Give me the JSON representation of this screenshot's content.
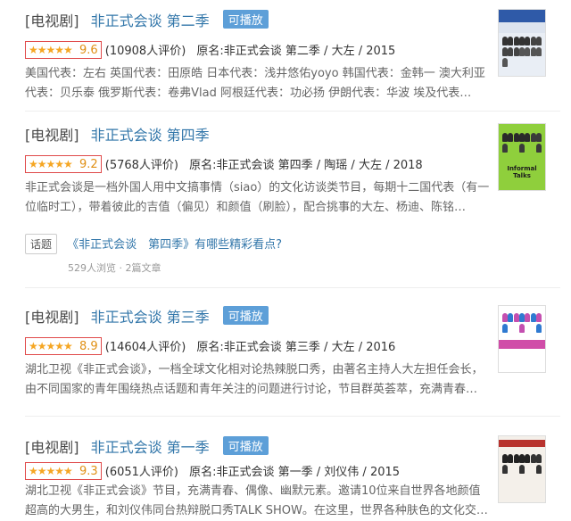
{
  "entries": [
    {
      "category": "[电视剧]",
      "title": "非正式会谈 第二季",
      "badge": "可播放",
      "stars": "★★★★★",
      "score": "9.6",
      "count": "(10908人评价)",
      "meta": "原名:非正式会谈 第二季 / 大左 / 2015",
      "desc": "美国代表：左右 英国代表：田原皓 日本代表：浅井悠佑yoyo 韩国代表：金韩一 澳大利亚代表：贝乐泰 俄罗斯代表：卷弗Vlad 阿根廷代表：功必扬 伊朗代表：华波 埃及代表…",
      "poster_color": "#2f5aa8"
    },
    {
      "category": "[电视剧]",
      "title": "非正式会谈 第四季",
      "badge": "",
      "stars": "★★★★★",
      "score": "9.2",
      "count": "(5768人评价)",
      "meta": "原名:非正式会谈 第四季 / 陶瑶 / 大左 / 2018",
      "desc": "非正式会谈是一档外国人用中文搞事情（siao）的文化访谈类节目，每期十二国代表（有一位临时工），带着彼此的吉值（偏见）和颜值（刷脸），配合挑事的大左、杨迪、陈铭…",
      "poster_color": "#8fcf3c",
      "poster_text": "Informal Talks"
    },
    {
      "category": "[电视剧]",
      "title": "非正式会谈 第三季",
      "badge": "可播放",
      "stars": "★★★★★",
      "score": "8.9",
      "count": "(14604人评价)",
      "meta": "原名:非正式会谈 第三季 / 大左 / 2016",
      "desc": "湖北卫视《非正式会谈》，一档全球文化相对论热辣脱口秀，由著名主持人大左担任会长，由不同国家的青年围绕热点话题和青年关注的问题进行讨论，节目群英荟萃，充满青春…",
      "poster_color": "#c44fb0"
    },
    {
      "category": "[电视剧]",
      "title": "非正式会谈 第一季",
      "badge": "可播放",
      "stars": "★★★★★",
      "score": "9.3",
      "count": "(6051人评价)",
      "meta": "原名:非正式会谈 第一季 / 刘仪伟 / 2015",
      "desc": "湖北卫视《非正式会谈》节目，充满青春、偶像、幽默元素。邀请10位来自世界各地颜值超高的大男生，和刘仪伟同台热辩脱口秀TALK SHOW。在这里，世界各种肤色的文化交…",
      "poster_color": "#b8332e"
    }
  ],
  "topic": {
    "tag": "话题",
    "link": "《非正式会谈　第四季》有哪些精彩看点?",
    "sub": "529人浏览 · 2篇文章"
  }
}
